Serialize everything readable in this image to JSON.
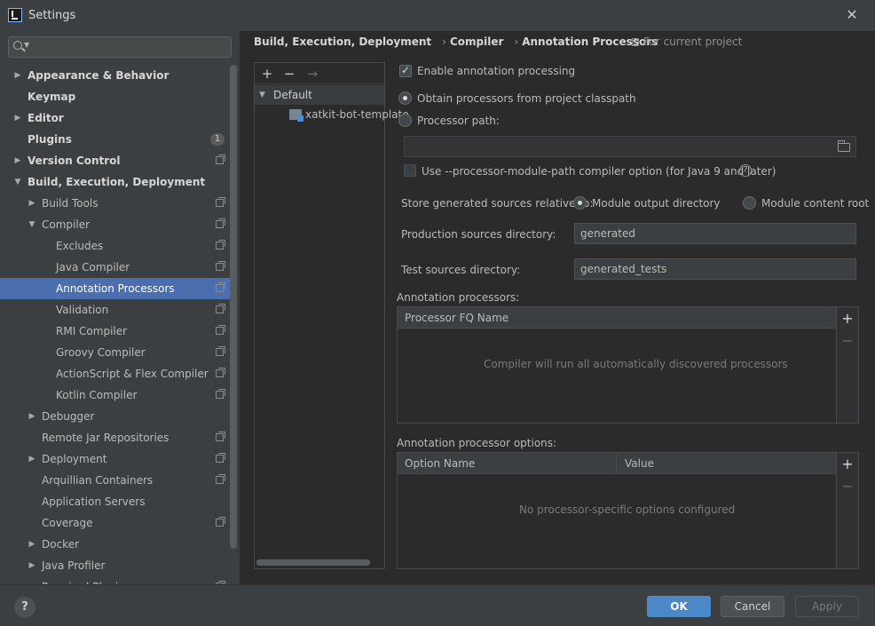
{
  "window": {
    "title": "Settings"
  },
  "sidebar": {
    "search": {
      "value": "",
      "placeholder": ""
    },
    "items": [
      {
        "label": "Appearance & Behavior",
        "bold": true,
        "expanded": false
      },
      {
        "label": "Keymap",
        "bold": true
      },
      {
        "label": "Editor",
        "bold": true,
        "expanded": false
      },
      {
        "label": "Plugins",
        "bold": true,
        "badge": "1"
      },
      {
        "label": "Version Control",
        "bold": true,
        "expanded": false
      },
      {
        "label": "Build, Execution, Deployment",
        "bold": true,
        "expanded": true
      },
      {
        "label": "Build Tools",
        "expanded": false
      },
      {
        "label": "Compiler",
        "expanded": true
      },
      {
        "label": "Excludes"
      },
      {
        "label": "Java Compiler"
      },
      {
        "label": "Annotation Processors",
        "selected": true
      },
      {
        "label": "Validation"
      },
      {
        "label": "RMI Compiler"
      },
      {
        "label": "Groovy Compiler"
      },
      {
        "label": "ActionScript & Flex Compiler"
      },
      {
        "label": "Kotlin Compiler"
      },
      {
        "label": "Debugger",
        "expanded": false
      },
      {
        "label": "Remote Jar Repositories"
      },
      {
        "label": "Deployment",
        "expanded": false
      },
      {
        "label": "Arquillian Containers"
      },
      {
        "label": "Application Servers"
      },
      {
        "label": "Coverage"
      },
      {
        "label": "Docker",
        "expanded": false
      },
      {
        "label": "Java Profiler",
        "expanded": false
      },
      {
        "label": "Required Plugins"
      }
    ]
  },
  "breadcrumb": {
    "items": [
      "Build, Execution, Deployment",
      "Compiler",
      "Annotation Processors"
    ],
    "scope": "For current project"
  },
  "profiles": {
    "toolbar": {
      "add": "+",
      "remove": "−",
      "move": "→"
    },
    "default_label": "Default",
    "module_label": "xatkit-bot-template"
  },
  "settings": {
    "enable_annotation_processing": "Enable annotation processing",
    "obtain_from_classpath": "Obtain processors from project classpath",
    "processor_path": "Processor path:",
    "processor_path_value": "",
    "use_module_path": "Use --processor-module-path compiler option (for Java 9 and later)",
    "store_relative_to": "Store generated sources relative to:",
    "module_output_directory": "Module output directory",
    "module_content_root": "Module content root",
    "production_sources_label": "Production sources directory:",
    "production_sources_value": "generated",
    "test_sources_label": "Test sources directory:",
    "test_sources_value": "generated_tests"
  },
  "annotation_processors": {
    "title": "Annotation processors:",
    "column": "Processor FQ Name",
    "empty": "Compiler will run all automatically discovered processors"
  },
  "processor_options": {
    "title": "Annotation processor options:",
    "columns": [
      "Option Name",
      "Value"
    ],
    "empty": "No processor-specific options configured"
  },
  "footer": {
    "help": "?",
    "ok": "OK",
    "cancel": "Cancel",
    "apply": "Apply"
  }
}
